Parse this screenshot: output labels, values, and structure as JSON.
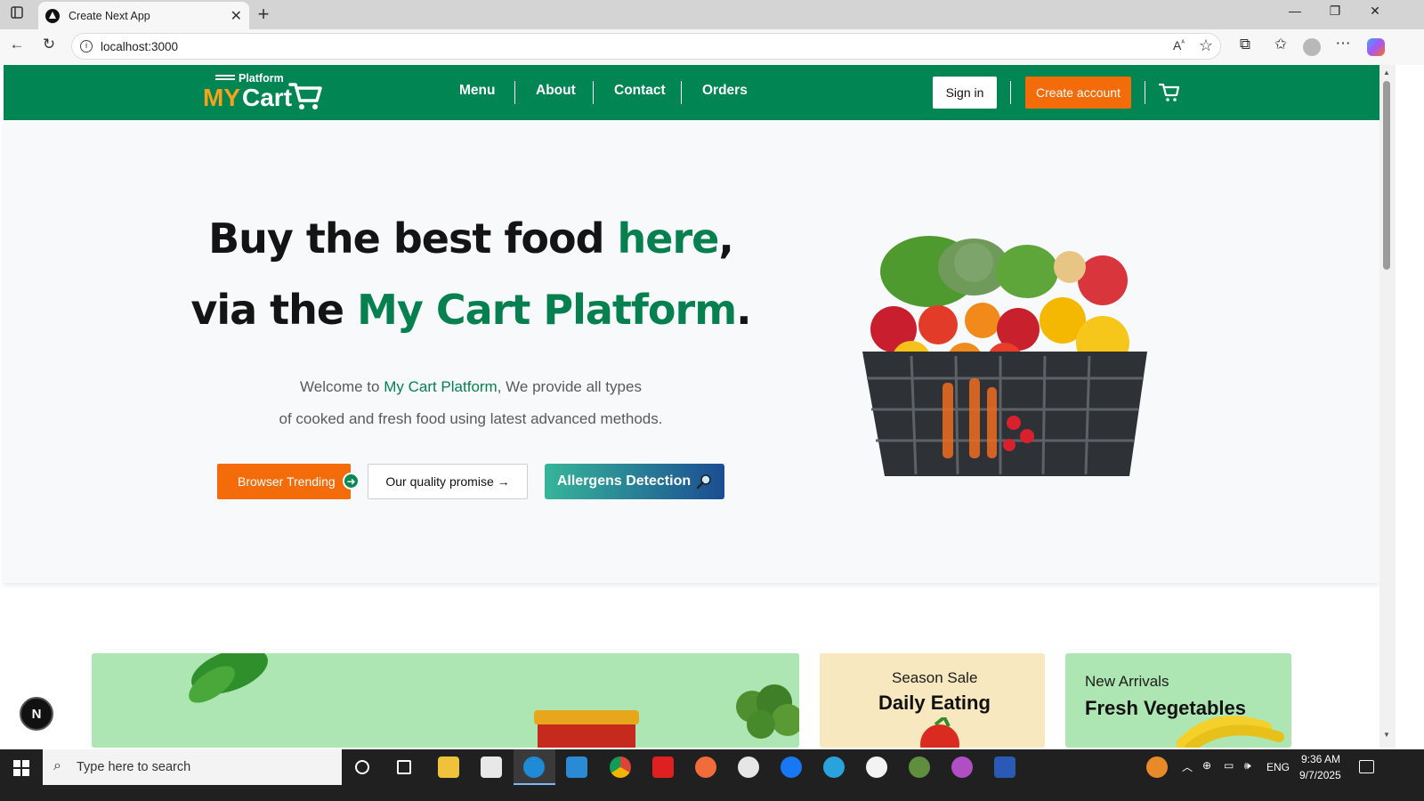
{
  "browser": {
    "tab_title": "Create Next App",
    "url": "localhost:3000"
  },
  "header": {
    "logo_platform": "Platform",
    "logo_my": "MY",
    "logo_cart": "Cart",
    "nav": [
      "Menu",
      "About",
      "Contact",
      "Orders"
    ],
    "signin_label": "Sign in",
    "create_label": "Create account"
  },
  "hero": {
    "line1_a": "Buy the best food ",
    "line1_b": "here",
    "line1_c": ",",
    "line2_a": "via the ",
    "line2_b": "My Cart Platform",
    "line2_c": ".",
    "sub1_a": "Welcome to ",
    "sub1_b": "My Cart Platform",
    "sub1_c": ", We provide all types",
    "sub2": "of cooked and fresh food using latest advanced methods.",
    "btn_trending": "Browser Trending",
    "btn_quality": "Our quality promise →",
    "btn_allergens": "Allergens Detection"
  },
  "cards": {
    "season_small": "Season Sale",
    "season_big": "Daily Eating",
    "arrivals_small": "New Arrivals",
    "arrivals_big": "Fresh Vegetables"
  },
  "next_badge": "N",
  "taskbar": {
    "search_placeholder": "Type here to search",
    "lang": "ENG",
    "time": "9:36 AM",
    "date": "9/7/2025"
  },
  "colors": {
    "brand_green": "#008553",
    "accent_orange": "#f46b0a"
  }
}
